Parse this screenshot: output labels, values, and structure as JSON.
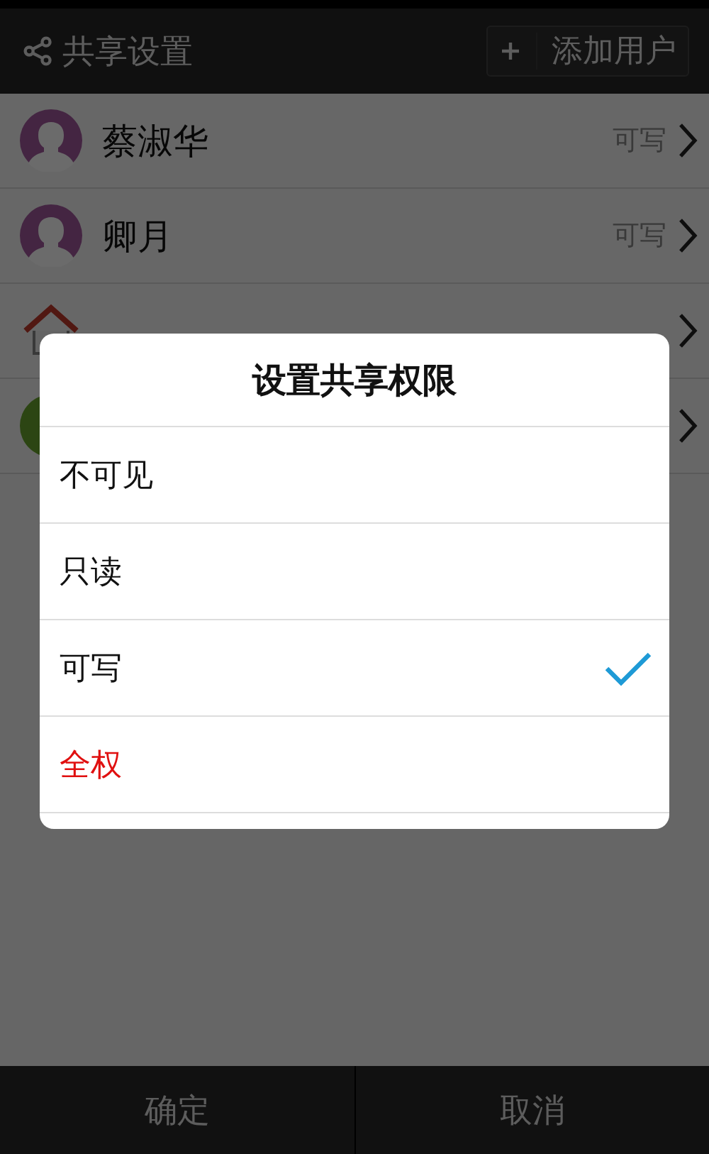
{
  "header": {
    "title": "共享设置",
    "add_button": "添加用户"
  },
  "users": [
    {
      "kind": "person",
      "name": "蔡淑华",
      "permission": "可写"
    },
    {
      "kind": "person",
      "name": "卿月",
      "permission": "可写"
    },
    {
      "kind": "group"
    },
    {
      "kind": "green"
    }
  ],
  "dialog": {
    "title": "设置共享权限",
    "options": [
      {
        "label": "不可见",
        "kind": "normal",
        "selected": false
      },
      {
        "label": "只读",
        "kind": "normal",
        "selected": false
      },
      {
        "label": "可写",
        "kind": "normal",
        "selected": true
      },
      {
        "label": "全权",
        "kind": "danger",
        "selected": false
      }
    ]
  },
  "footer": {
    "buttons": [
      "确定",
      "取消"
    ]
  }
}
